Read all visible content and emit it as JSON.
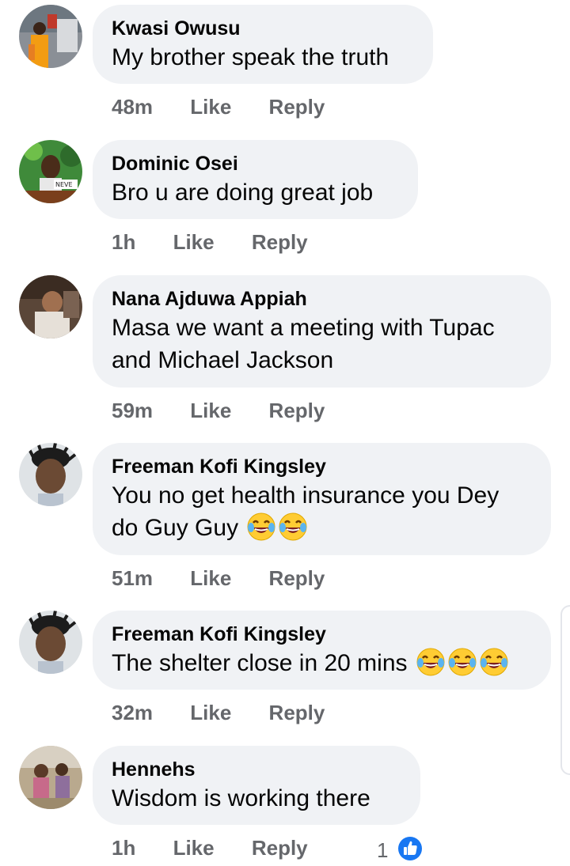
{
  "comments": [
    {
      "author": "Kwasi Owusu",
      "text": "My brother speak the truth",
      "time": "48m",
      "like": "Like",
      "reply": "Reply"
    },
    {
      "author": "Dominic Osei",
      "text": "Bro u are doing great job",
      "time": "1h",
      "like": "Like",
      "reply": "Reply"
    },
    {
      "author": "Nana Ajduwa Appiah",
      "text_line1": "Masa we want a meeting with Tupac",
      "text_line2": "and Michael Jackson",
      "time": "59m",
      "like": "Like",
      "reply": "Reply"
    },
    {
      "author": "Freeman Kofi Kingsley",
      "text_line1": "You no get health insurance you Dey",
      "text_line2": "do Guy Guy",
      "emoji": "laughing-crying-emoji",
      "time": "51m",
      "like": "Like",
      "reply": "Reply"
    },
    {
      "author": "Freeman Kofi Kingsley",
      "text": "The shelter close in 20 mins",
      "emoji": "laughing-crying-emoji",
      "time": "32m",
      "like": "Like",
      "reply": "Reply"
    },
    {
      "author": "Hennehs",
      "text": "Wisdom is working there",
      "time": "1h",
      "like": "Like",
      "reply": "Reply",
      "reaction_count": "1",
      "reaction_icon": "thumbs-up-icon"
    }
  ],
  "colors": {
    "bubble": "#f0f2f5",
    "meta": "#65676b",
    "like_blue": "#1877f2",
    "emoji_yellow": "#ffcc33"
  }
}
